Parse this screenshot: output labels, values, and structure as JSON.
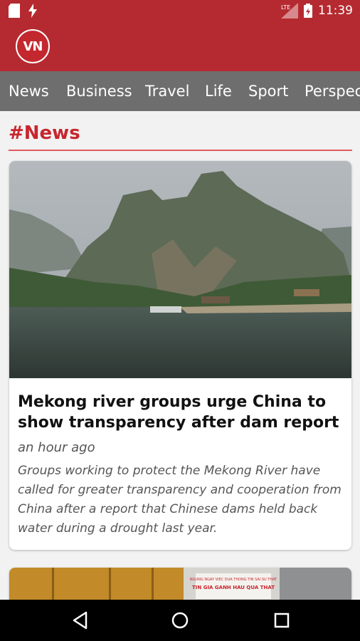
{
  "status_bar": {
    "time": "11:39",
    "network": "LTE"
  },
  "app": {
    "logo_text": "VN"
  },
  "tabs": [
    "News",
    "Business",
    "Travel",
    "Life",
    "Sport",
    "Perspectives"
  ],
  "section": {
    "title": "#News"
  },
  "articles": [
    {
      "title": "Mekong river groups urge China to show transparency after dam report",
      "time": "an hour ago",
      "summary": "Groups working to protect the Mekong River have called for greater transparency and cooperation from China after a report that Chinese dams held back water during a drought last year."
    },
    {
      "sign_line1": "NGUNG NGAY VIEC DUA THONG TIN SAI SU THAT",
      "sign_line2": "TIN GIA GANH HAU QUA THAT"
    }
  ],
  "colors": {
    "brand": "#b52a30",
    "accent": "#c7262e",
    "tab_bar": "#6e6e6e"
  },
  "icons": [
    "sd-card-icon",
    "flash-icon",
    "signal-icon",
    "battery-icon",
    "back-icon",
    "home-icon",
    "recents-icon"
  ]
}
